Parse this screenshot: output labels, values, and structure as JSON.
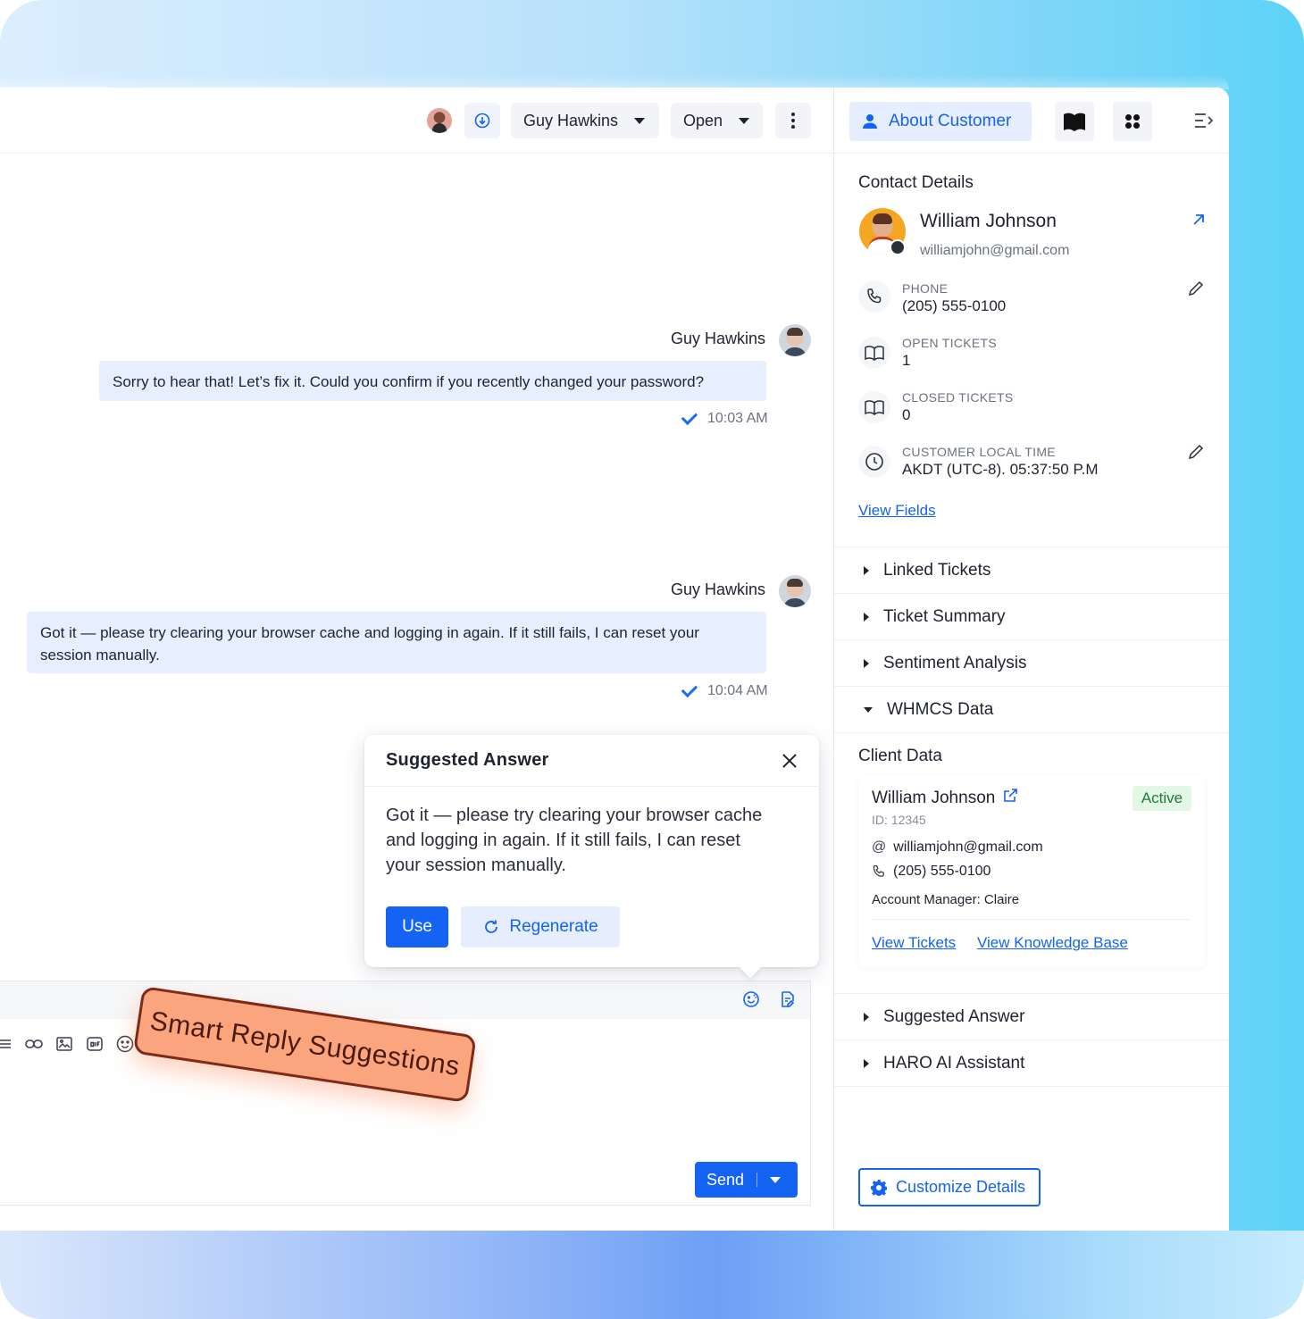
{
  "header": {
    "assignee": "Guy Hawkins",
    "status": "Open"
  },
  "messages": [
    {
      "sender": "Guy Hawkins",
      "text": "Sorry to hear that! Let’s fix it. Could you confirm if you recently changed your password?",
      "time": "10:03 AM"
    },
    {
      "sender": "Guy Hawkins",
      "text": "Got it — please try clearing your browser cache and logging in again. If it still fails, I can reset your session manually.",
      "time": "10:04 AM"
    }
  ],
  "suggestion": {
    "title": "Suggested Answer",
    "text": "Got it — please try clearing your browser cache and logging in again. If it still fails, I can reset your session manually.",
    "use_label": "Use",
    "regenerate_label": "Regenerate"
  },
  "composer": {
    "send_label": "Send"
  },
  "sticker": {
    "text": "Smart Reply Suggestions",
    "color": "#fba57e"
  },
  "side": {
    "about_tab": "About Customer",
    "contact_title": "Contact Details",
    "customer": {
      "name": "William Johnson",
      "email": "williamjohn@gmail.com"
    },
    "details": [
      {
        "label": "PHONE",
        "value": "(205) 555-0100"
      },
      {
        "label": "OPEN TICKETS",
        "value": "1"
      },
      {
        "label": "CLOSED TICKETS",
        "value": "0"
      },
      {
        "label": "CUSTOMER LOCAL TIME",
        "value": "AKDT (UTC-8). 05:37:50 P.M"
      }
    ],
    "view_fields": "View Fields",
    "accordion": [
      {
        "label": "Linked Tickets",
        "expanded": false
      },
      {
        "label": "Ticket Summary",
        "expanded": false
      },
      {
        "label": "Sentiment Analysis",
        "expanded": false
      },
      {
        "label": "WHMCS Data",
        "expanded": true
      }
    ],
    "client_data": {
      "title": "Client Data",
      "name": "William Johnson",
      "status": "Active",
      "id": "ID: 12345",
      "email": "williamjohn@gmail.com",
      "phone": "(205) 555-0100",
      "account_manager": "Account Manager: Claire",
      "view_tickets": "View Tickets",
      "view_kb": "View Knowledge Base"
    },
    "accordion_bottom": [
      {
        "label": "Suggested Answer",
        "expanded": false
      },
      {
        "label": "HARO AI Assistant",
        "expanded": false
      }
    ],
    "customize_label": "Customize Details"
  },
  "colors": {
    "accent": "#1463f3",
    "bubble": "#e7eefd",
    "active_bg": "#e3f7e5"
  }
}
